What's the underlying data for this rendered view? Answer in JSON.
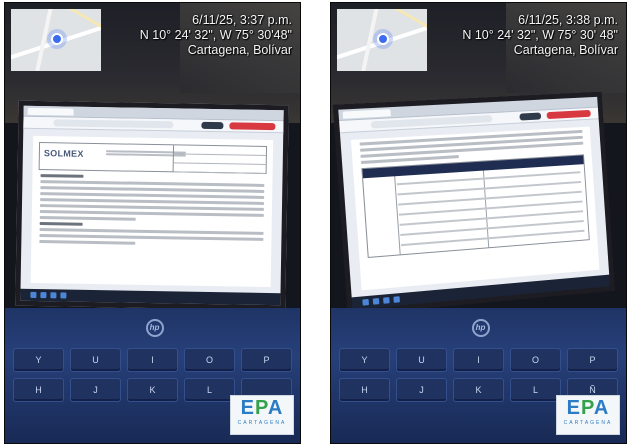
{
  "photos": [
    {
      "id_label": "left",
      "timestamp": "6/11/25, 3:37 p.m.",
      "coords": "N 10° 24' 32\", W 75° 30'48\"",
      "place": "Cartagena, Bolívar",
      "logo_text": "SOLMEX",
      "keys_row1": [
        "Y",
        "U",
        "I",
        "O",
        "P"
      ],
      "keys_row2": [
        "H",
        "J",
        "K",
        "L"
      ],
      "watermark": "EPA",
      "watermark_sub": "CARTAGENA"
    },
    {
      "id_label": "right",
      "timestamp": "6/11/25, 3:38 p.m.",
      "coords": "N 10° 24' 32\", W 75° 30' 48\"",
      "place": "Cartagena, Bolívar",
      "keys_row1": [
        "Y",
        "U",
        "I",
        "O",
        "P"
      ],
      "keys_row2": [
        "H",
        "J",
        "K",
        "L",
        "Ñ"
      ],
      "watermark": "EPA",
      "watermark_sub": "CARTAGENA"
    }
  ],
  "colors": {
    "laptop_blue": "#27407a",
    "screen_bg": "#e9edf3",
    "epa_blue": "#2b7cc4",
    "epa_green": "#35a14b",
    "table_header": "#1f2d52"
  }
}
